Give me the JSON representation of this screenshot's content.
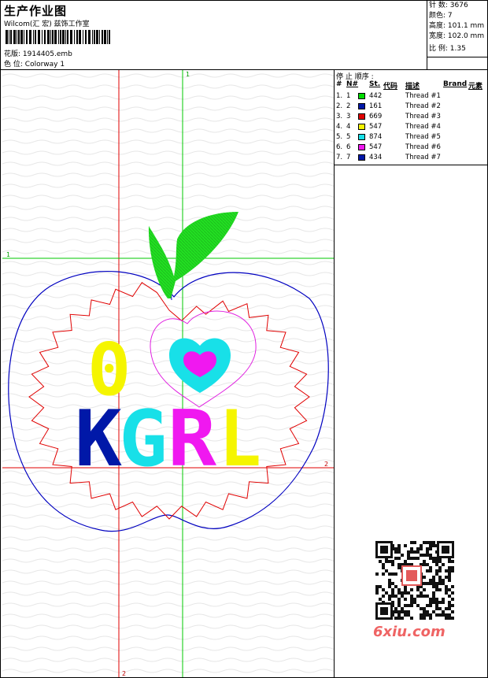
{
  "header": {
    "title": "生产作业图",
    "subtitle": "Wilcom(汇 宏) 兹饰工作室",
    "design_label": "花版:",
    "design_value": "1914405.emb",
    "colorway_label": "色 位:",
    "colorway_value": "Colorway 1"
  },
  "stats": [
    {
      "label": "针 数:",
      "value": "3676"
    },
    {
      "label": "颜色:",
      "value": "7"
    },
    {
      "label": "高度:",
      "value": "101.1 mm"
    },
    {
      "label": "宽度:",
      "value": "102.0 mm"
    },
    {
      "label": "比 例:",
      "value": "1.35"
    }
  ],
  "canvas": {
    "axis_markers": {
      "top": "1",
      "left": "1",
      "right": "2",
      "bottom": "2"
    },
    "artwork_text": {
      "digit": "0",
      "word": "KGRL"
    },
    "colors": {
      "guide_red": "#e00000",
      "guide_green": "#00c800",
      "apple_outline": "#0000c0",
      "zigzag": "#e00000",
      "heart_outline": "#e020e0"
    }
  },
  "legend": {
    "title": "停 止 顺序 :",
    "headers": {
      "hash": "#",
      "num": "N#",
      "st": "St.",
      "code": "代码",
      "desc": "描述",
      "brand": "Brand",
      "element": "元素"
    },
    "threads": [
      {
        "idx": "1.",
        "n": "1",
        "color": "#00dc00",
        "code": "442",
        "desc": "Thread #1"
      },
      {
        "idx": "2.",
        "n": "2",
        "color": "#0018a8",
        "code": "161",
        "desc": "Thread #2"
      },
      {
        "idx": "3.",
        "n": "3",
        "color": "#e00000",
        "code": "669",
        "desc": "Thread #3"
      },
      {
        "idx": "4.",
        "n": "4",
        "color": "#f5f500",
        "code": "547",
        "desc": "Thread #4"
      },
      {
        "idx": "5.",
        "n": "5",
        "color": "#18e0e8",
        "code": "874",
        "desc": "Thread #5"
      },
      {
        "idx": "6.",
        "n": "6",
        "color": "#f018f0",
        "code": "547",
        "desc": "Thread #6"
      },
      {
        "idx": "7.",
        "n": "7",
        "color": "#0018a8",
        "code": "434",
        "desc": "Thread #7"
      }
    ]
  },
  "watermark": {
    "text": "6xiu.com",
    "color": "#ef6464"
  }
}
